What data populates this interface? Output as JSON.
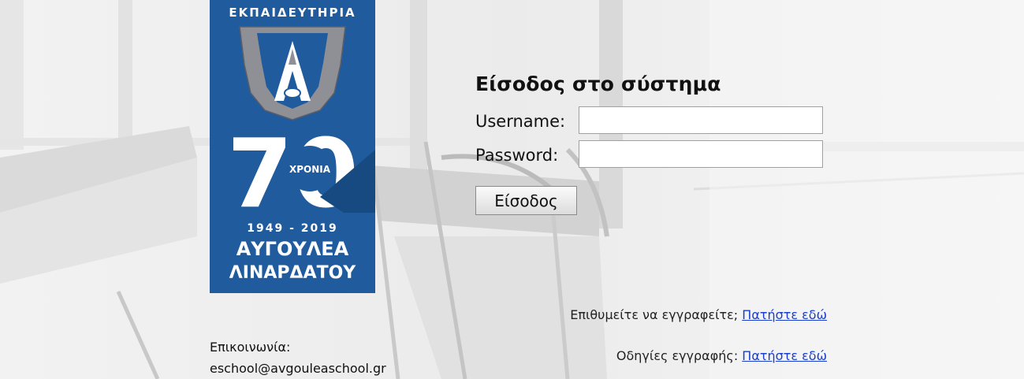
{
  "logo": {
    "top_text": "ΕΚΠΑΙΔΕΥΤΗΡΙΑ",
    "anniversary_number": "70",
    "anniversary_word": "ΧΡΟΝΙΑ",
    "years": "1949 - 2019",
    "name_line1": "ΑΥΓΟΥΛΕΑ",
    "name_line2": "ΛΙΝΑΡΔΑΤΟΥ",
    "colors": {
      "background": "#1f5b9d",
      "shield": "#8e9096",
      "dark": "#0f2f5c"
    }
  },
  "login": {
    "title": "Είσοδος στο σύστημα",
    "username_label": "Username:",
    "username_value": "",
    "password_label": "Password:",
    "password_value": "",
    "submit_label": "Είσοδος"
  },
  "links": {
    "register_prompt": "Επιθυμείτε να εγγραφείτε;",
    "register_link": "Πατήστε εδώ",
    "instructions_prompt": "Οδηγίες εγγραφής:",
    "instructions_link": "Πατήστε εδώ",
    "link_color": "#1a3fcf"
  },
  "contact": {
    "label": "Επικοινωνία:",
    "email": "eschool@avgouleaschool.gr"
  }
}
